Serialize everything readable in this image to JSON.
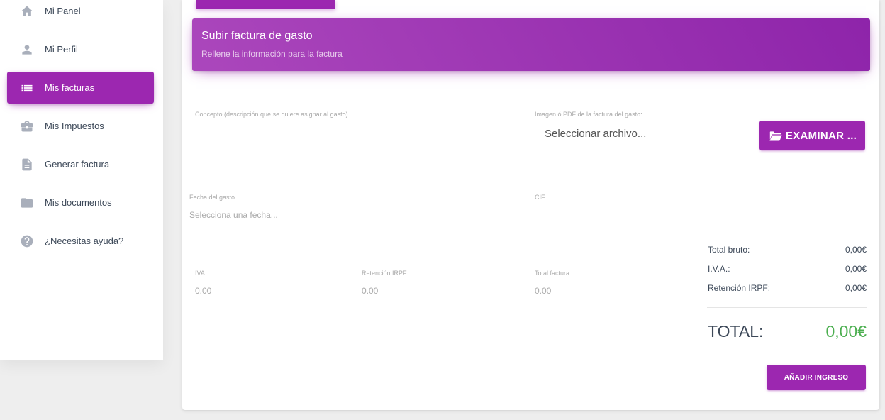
{
  "sidebar": {
    "items": [
      {
        "label": "Mi Panel",
        "icon": "home-icon",
        "active": false
      },
      {
        "label": "Mi Perfil",
        "icon": "person-icon",
        "active": false
      },
      {
        "label": "Mis facturas",
        "icon": "list-icon",
        "active": true
      },
      {
        "label": "Mis Impuestos",
        "icon": "briefcase-icon",
        "active": false
      },
      {
        "label": "Generar factura",
        "icon": "document-icon",
        "active": false
      },
      {
        "label": "Mis documentos",
        "icon": "folder-icon",
        "active": false
      },
      {
        "label": "¿Necesitas ayuda?",
        "icon": "help-icon",
        "active": false
      }
    ]
  },
  "card": {
    "title": "Subir factura de gasto",
    "subtitle": "Rellene la información para la factura"
  },
  "form": {
    "concepto_label": "Concepto (descripción que se quiere asignar al gasto)",
    "imagen_label": "Imagen ó PDF de la factura del gasto:",
    "file_placeholder": "Seleccionar archivo...",
    "examinar_label": "EXAMINAR ...",
    "fecha_label": "Fecha del gasto",
    "fecha_placeholder": "Selecciona una fecha...",
    "cif_label": "CIF",
    "iva_label": "IVA",
    "iva_value": "0.00",
    "retencion_label": "Retención IRPF",
    "retencion_value": "0.00",
    "total_factura_label": "Total factura:",
    "total_factura_value": "0.00"
  },
  "summary": {
    "total_bruto_label": "Total bruto:",
    "total_bruto_value": "0,00€",
    "iva_label": "I.V.A.:",
    "iva_value": "0,00€",
    "retencion_label": "Retención IRPF:",
    "retencion_value": "0,00€",
    "total_label": "TOTAL:",
    "total_value": "0,00€"
  },
  "actions": {
    "add_label": "AÑADIR INGRESO"
  },
  "colors": {
    "accent": "#9c27b0",
    "total_green": "#4caf50"
  }
}
